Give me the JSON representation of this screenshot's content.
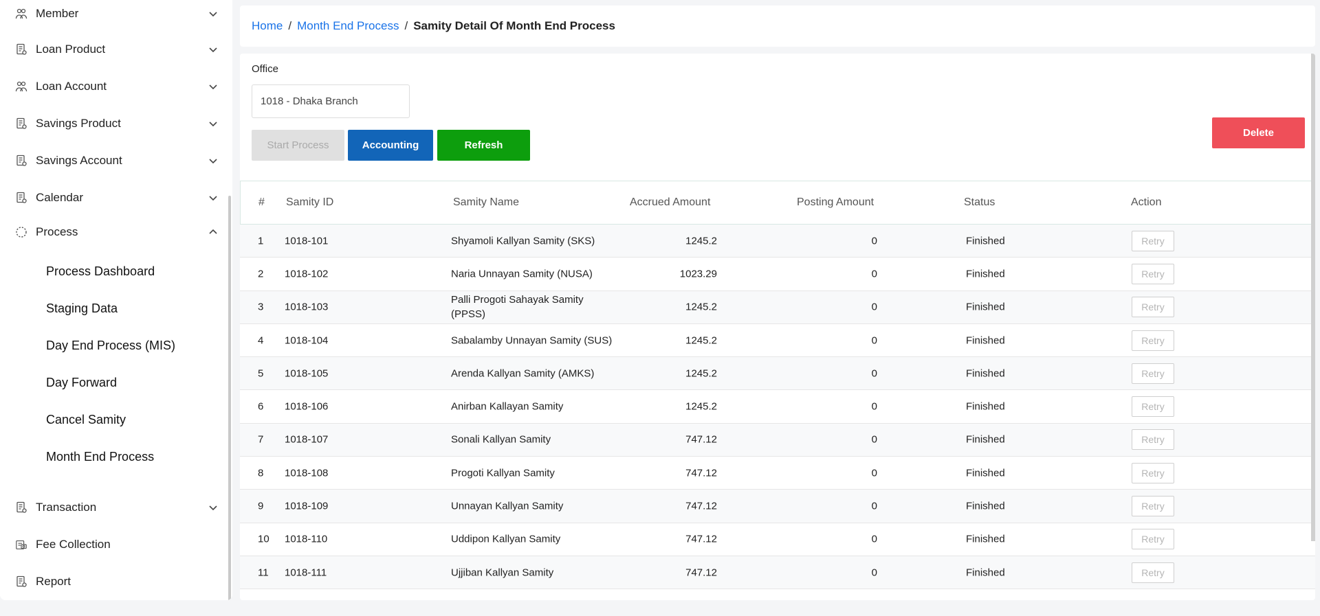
{
  "sidebar": {
    "items": [
      {
        "label": "Member",
        "icon": "users-icon",
        "chevron": "down"
      },
      {
        "label": "Loan Product",
        "icon": "document-icon",
        "chevron": "down"
      },
      {
        "label": "Loan Account",
        "icon": "users-icon",
        "chevron": "down"
      },
      {
        "label": "Savings Product",
        "icon": "document-icon",
        "chevron": "down"
      },
      {
        "label": "Savings Account",
        "icon": "document-icon",
        "chevron": "down"
      },
      {
        "label": "Calendar",
        "icon": "document-icon",
        "chevron": "down"
      },
      {
        "label": "Process",
        "icon": "spinner-icon",
        "chevron": "up"
      }
    ],
    "process_sub": [
      "Process Dashboard",
      "Staging Data",
      "Day End Process (MIS)",
      "Day Forward",
      "Cancel Samity",
      "Month End Process"
    ],
    "bottom_items": [
      {
        "label": "Transaction",
        "icon": "document-icon",
        "chevron": "down"
      },
      {
        "label": "Fee Collection",
        "icon": "money-icon"
      },
      {
        "label": "Report",
        "icon": "document-icon"
      }
    ]
  },
  "breadcrumb": {
    "home": "Home",
    "month_end": "Month End Process",
    "current": "Samity Detail Of Month End Process"
  },
  "office": {
    "label": "Office",
    "value": "1018 - Dhaka Branch"
  },
  "buttons": {
    "start": "Start Process",
    "accounting": "Accounting",
    "refresh": "Refresh",
    "delete": "Delete"
  },
  "table": {
    "headers": [
      "#",
      "Samity ID",
      "Samity Name",
      "Accrued Amount",
      "Posting Amount",
      "Status",
      "Action"
    ],
    "retry_label": "Retry",
    "rows": [
      {
        "no": "1",
        "id": "1018-101",
        "name": "Shyamoli Kallyan Samity (SKS)",
        "accrued": "1245.2",
        "posting": "0",
        "status": "Finished"
      },
      {
        "no": "2",
        "id": "1018-102",
        "name": "Naria Unnayan Samity (NUSA)",
        "accrued": "1023.29",
        "posting": "0",
        "status": "Finished"
      },
      {
        "no": "3",
        "id": "1018-103",
        "name": "Palli Progoti Sahayak Samity (PPSS)",
        "accrued": "1245.2",
        "posting": "0",
        "status": "Finished"
      },
      {
        "no": "4",
        "id": "1018-104",
        "name": "Sabalamby Unnayan Samity (SUS)",
        "accrued": "1245.2",
        "posting": "0",
        "status": "Finished"
      },
      {
        "no": "5",
        "id": "1018-105",
        "name": "Arenda Kallyan Samity (AMKS)",
        "accrued": "1245.2",
        "posting": "0",
        "status": "Finished"
      },
      {
        "no": "6",
        "id": "1018-106",
        "name": "Anirban Kallayan Samity",
        "accrued": "1245.2",
        "posting": "0",
        "status": "Finished"
      },
      {
        "no": "7",
        "id": "1018-107",
        "name": "Sonali Kallyan Samity",
        "accrued": "747.12",
        "posting": "0",
        "status": "Finished"
      },
      {
        "no": "8",
        "id": "1018-108",
        "name": "Progoti Kallyan Samity",
        "accrued": "747.12",
        "posting": "0",
        "status": "Finished"
      },
      {
        "no": "9",
        "id": "1018-109",
        "name": "Unnayan Kallyan Samity",
        "accrued": "747.12",
        "posting": "0",
        "status": "Finished"
      },
      {
        "no": "10",
        "id": "1018-110",
        "name": "Uddipon Kallyan Samity",
        "accrued": "747.12",
        "posting": "0",
        "status": "Finished"
      },
      {
        "no": "11",
        "id": "1018-111",
        "name": "Ujjiban Kallyan Samity",
        "accrued": "747.12",
        "posting": "0",
        "status": "Finished"
      }
    ]
  }
}
